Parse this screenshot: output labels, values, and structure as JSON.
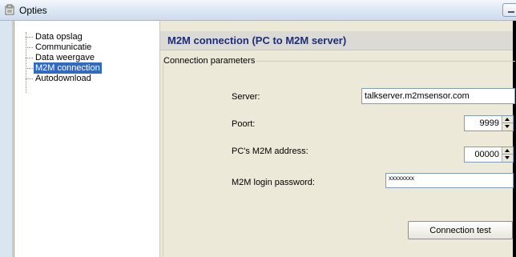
{
  "window": {
    "title": "Opties",
    "icon": "options-window-icon"
  },
  "tree": {
    "items": [
      {
        "label": "Data opslag",
        "selected": false
      },
      {
        "label": "Communicatie",
        "selected": false
      },
      {
        "label": "Data weergave",
        "selected": false
      },
      {
        "label": "M2M connection",
        "selected": true
      },
      {
        "label": "Autodownload",
        "selected": false
      }
    ]
  },
  "panel": {
    "header": "M2M connection (PC to M2M server)",
    "group_title": "Connection parameters",
    "server": {
      "label": "Server:",
      "value": "talkserver.m2msensor.com"
    },
    "port": {
      "label": "Poort:",
      "value": "9999"
    },
    "address": {
      "label": "PC's M2M address:",
      "value": "00000"
    },
    "password": {
      "label": "M2M login password:",
      "value": "xxxxxxxx"
    },
    "test_button": "Connection test"
  },
  "colors": {
    "selection": "#316ac5",
    "header_text": "#1c2e78",
    "panel_bg": "#ece9d8"
  }
}
